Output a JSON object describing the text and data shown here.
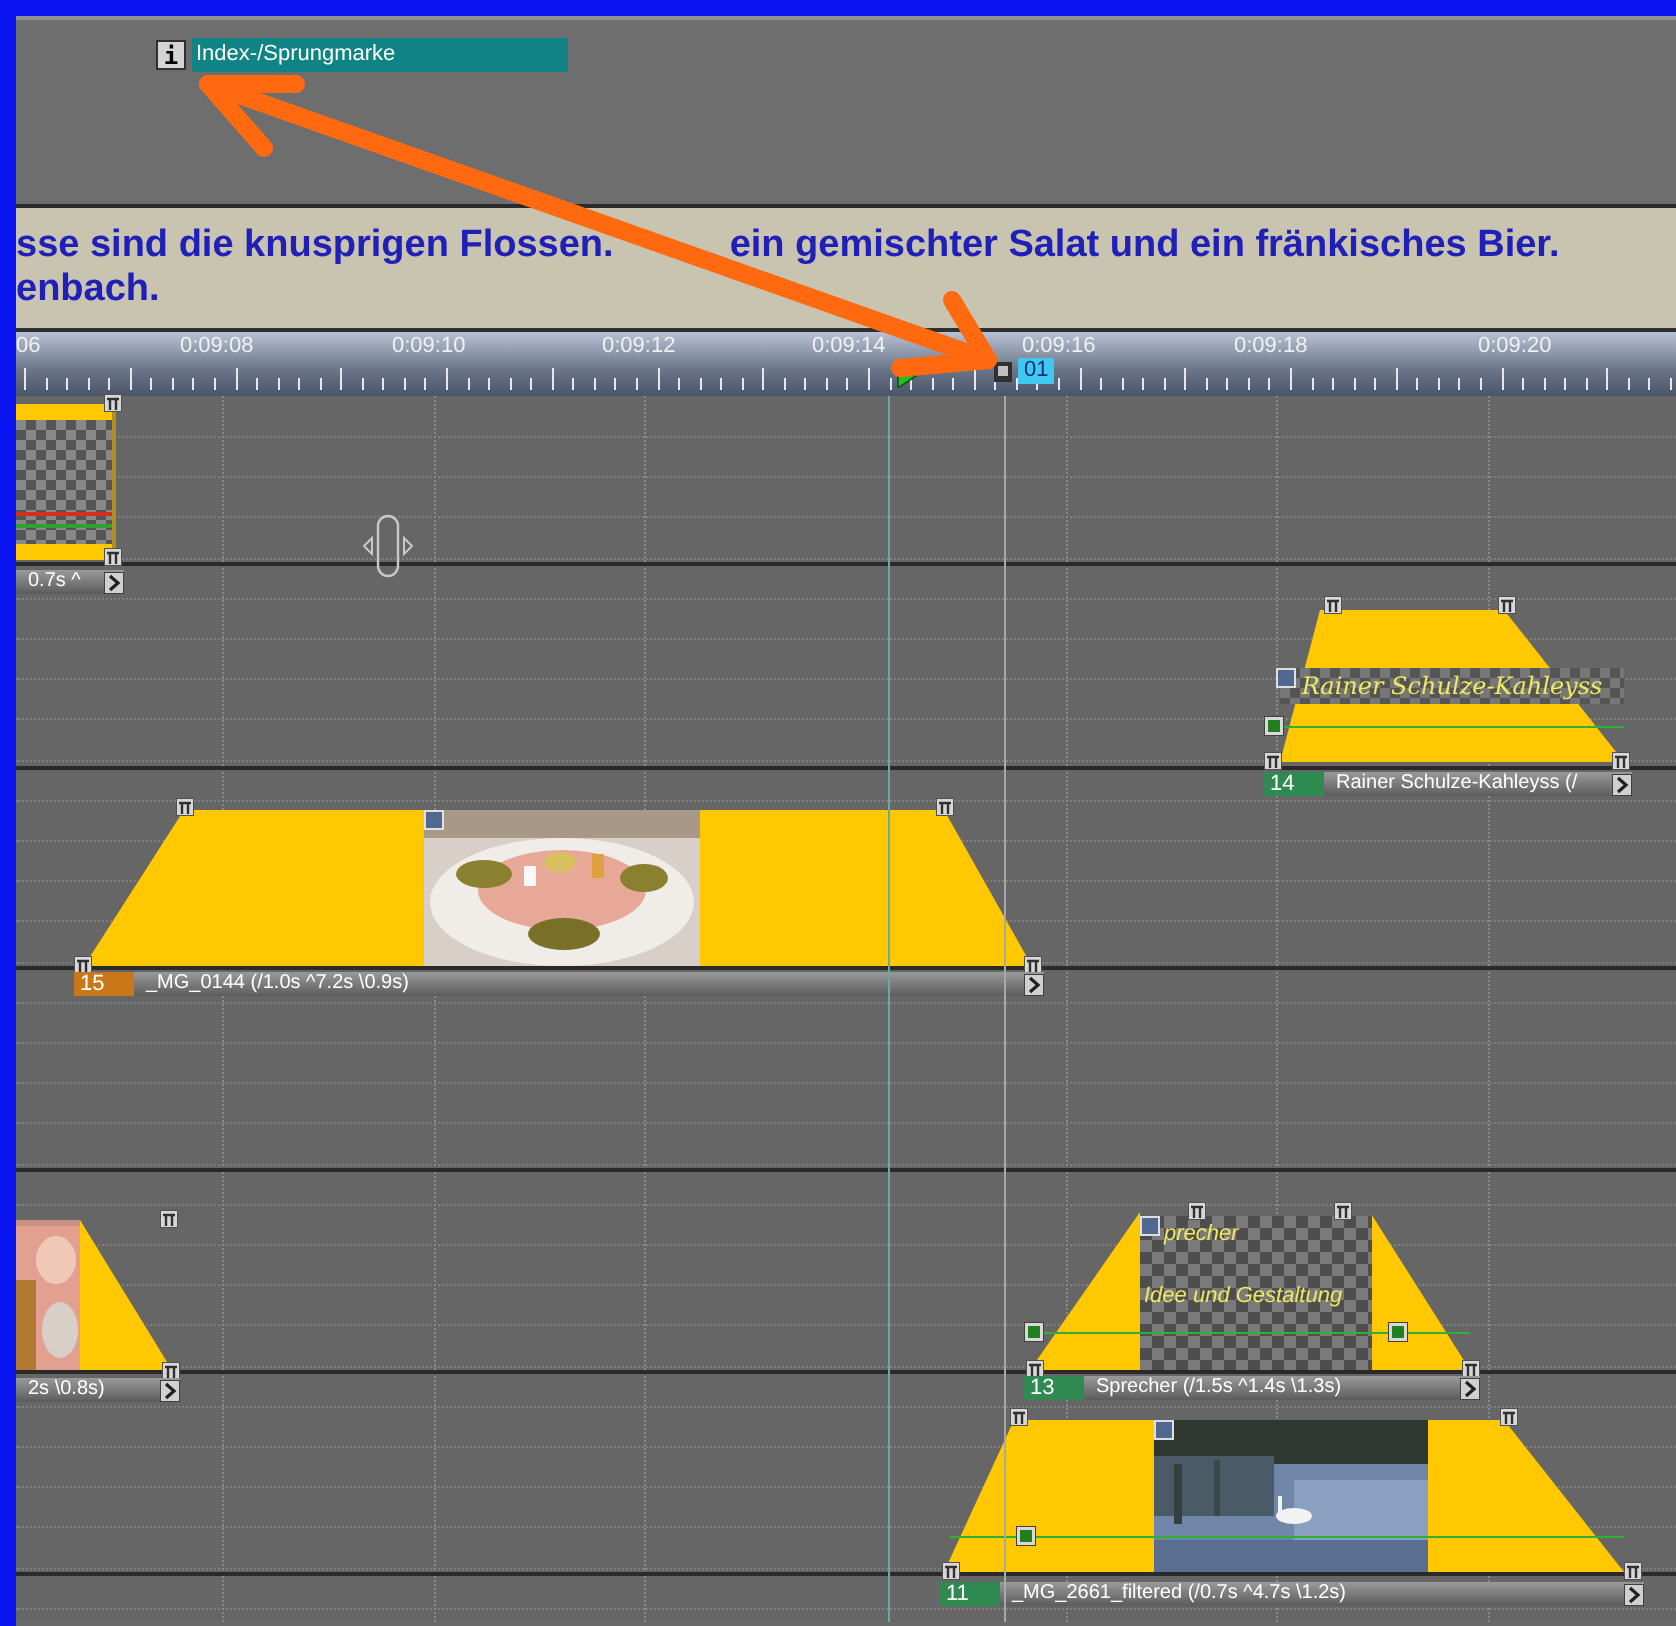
{
  "marker_lane": {
    "marker": {
      "icon": "i",
      "label": "Index-/Sprungmarke"
    }
  },
  "caption": {
    "lines": [
      [
        "sse sind die knusprigen Flossen.",
        "ein gemischter Salat und ein fränkisches Bier."
      ],
      [
        "enbach."
      ]
    ]
  },
  "ruler": {
    "ticks": [
      "06",
      "0:09:08",
      "0:09:10",
      "0:09:12",
      "0:09:14",
      "0:09:16",
      "0:09:18",
      "0:09:20"
    ],
    "index_marker": {
      "label": "01"
    }
  },
  "clips": [
    {
      "kind": "transition",
      "label": "0.7s ^"
    },
    {
      "kind": "title",
      "number": "14",
      "color": "#2f8a52",
      "label": "Rainer Schulze-Kahleyss (/",
      "text_lines": [
        "Rainer Schulze-Kahleyss"
      ]
    },
    {
      "number": "15",
      "color": "#c87818",
      "label": "_MG_0144 (/1.0s ^7.2s \\0.9s)"
    },
    {
      "label": "2s \\0.8s)"
    },
    {
      "kind": "title",
      "number": "13",
      "color": "#2f8a52",
      "label": "Sprecher (/1.5s ^1.4s \\1.3s)",
      "text_lines": [
        "precher",
        "Idee und Gestaltung"
      ]
    },
    {
      "number": "11",
      "color": "#2f8a52",
      "label": "_MG_2661_filtered (/0.7s ^4.7s \\1.2s)"
    }
  ]
}
